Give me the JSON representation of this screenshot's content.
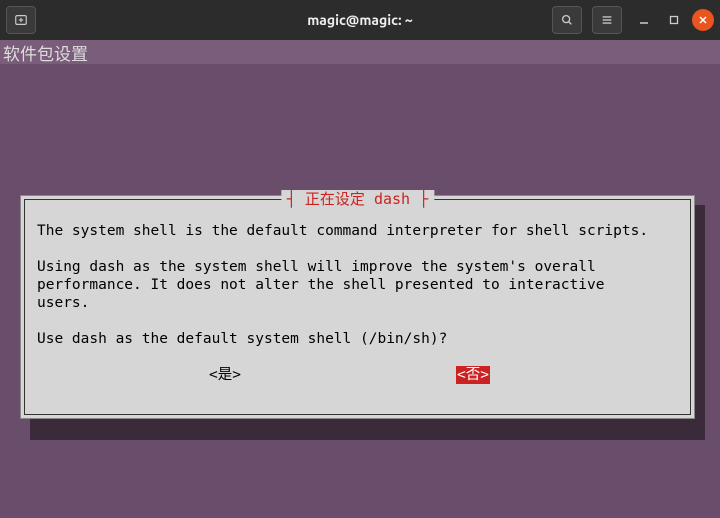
{
  "titlebar": {
    "title": "magic@magic: ~"
  },
  "terminal": {
    "header": "软件包设置"
  },
  "dialog": {
    "title": "┤ 正在设定 dash ├",
    "line1": "The system shell is the default command interpreter for shell scripts.",
    "line2": "Using dash as the system shell will improve the system's overall",
    "line3": "performance. It does not alter the shell presented to interactive",
    "line4": "users.",
    "line5": "Use dash as the default system shell (/bin/sh)?",
    "yes_label": "<是>",
    "no_label": "<否>"
  }
}
